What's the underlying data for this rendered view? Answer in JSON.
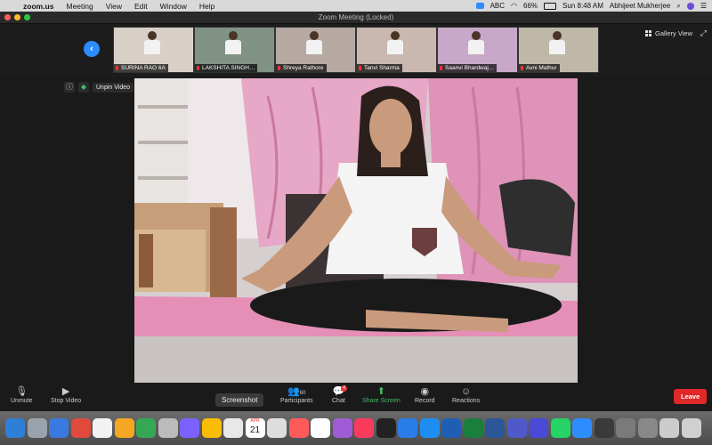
{
  "menubar": {
    "app": "zoom.us",
    "items": [
      "Meeting",
      "View",
      "Edit",
      "Window",
      "Help"
    ],
    "abc": "ABC",
    "battery": "66%",
    "clock": "Sun 8:48 AM",
    "user": "Abhijeet Mukherjee"
  },
  "window": {
    "title": "Zoom Meeting (Locked)"
  },
  "gallery": {
    "label": "Gallery View",
    "participants": [
      {
        "name": "SURINA RAO 6A",
        "bg": "#d8d0c7"
      },
      {
        "name": "LAKSHITA SINGH…",
        "bg": "#8a9a8c"
      },
      {
        "name": "Shreya Rathore",
        "bg": "#b5a9a1"
      },
      {
        "name": "Tanvi Sharma",
        "bg": "#c9b7b0"
      },
      {
        "name": "Saanvi Bhardwaj…",
        "bg": "#c7a8c8"
      },
      {
        "name": "Avni Mathur",
        "bg": "#bfb8a8"
      }
    ]
  },
  "video": {
    "unpin_label": "Unpin Video"
  },
  "toolbar": {
    "unmute": "Unmute",
    "stop_video": "Stop Video",
    "screenshot": "Screenshot",
    "participants": "Participants",
    "participant_count": "60",
    "chat": "Chat",
    "chat_badge": "4",
    "share_screen": "Share Screen",
    "record": "Record",
    "reactions": "Reactions",
    "leave": "Leave"
  },
  "dock": {
    "calendar_day": "21",
    "calendar_month": "APR",
    "icon_colors": [
      "#2f7fd6",
      "#9aa3ad",
      "#3a7ae0",
      "#e04a3c",
      "#f2f2f2",
      "#f5a623",
      "#34a853",
      "#bbbbbb",
      "#7b61ff",
      "#fbbc05",
      "#e8e8e8",
      "#c79a5b",
      "#dddddd",
      "#ff5a5a",
      "#ffffff",
      "#a05cd6",
      "#fa3c5c",
      "#222222",
      "#2b7de9",
      "#1d8ff2",
      "#1e5fb4",
      "#1a7f3c",
      "#2b5797",
      "#5059c9",
      "#4a4ad6",
      "#25d366",
      "#2d8cff",
      "#3a3a3a",
      "#7a7a7a",
      "#888888",
      "#cccccc",
      "#d0d0d0"
    ]
  }
}
